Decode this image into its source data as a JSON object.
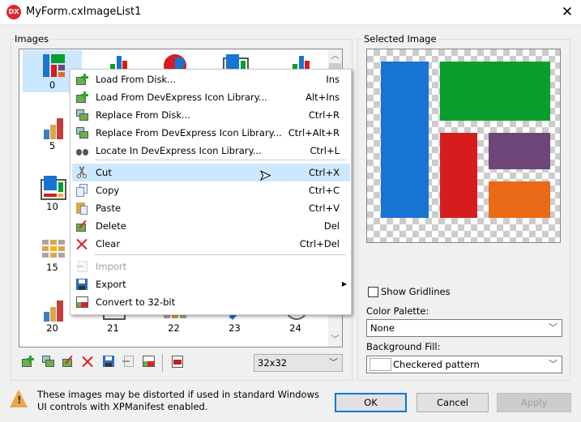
{
  "window": {
    "title": "MyForm.cxImageList1",
    "logo_text": "DX",
    "close_glyph": "✕"
  },
  "images_group": {
    "label": "Images",
    "cells": [
      {
        "label": "0",
        "icon": "layout-icon",
        "selected": true
      },
      {
        "label": "",
        "icon": "bar-chart-icon"
      },
      {
        "label": "",
        "icon": "pie-chart-icon"
      },
      {
        "label": "",
        "icon": "dashboard-icon"
      },
      {
        "label": "",
        "icon": "bar-chart-icon"
      },
      {
        "label": "5",
        "icon": "bar-chart-3d-icon"
      },
      {
        "label": "",
        "icon": ""
      },
      {
        "label": "",
        "icon": ""
      },
      {
        "label": "",
        "icon": ""
      },
      {
        "label": "",
        "icon": ""
      },
      {
        "label": "10",
        "icon": "dashboard-icon"
      },
      {
        "label": "",
        "icon": ""
      },
      {
        "label": "",
        "icon": ""
      },
      {
        "label": "",
        "icon": ""
      },
      {
        "label": "",
        "icon": ""
      },
      {
        "label": "15",
        "icon": "grid-icon"
      },
      {
        "label": "",
        "icon": ""
      },
      {
        "label": "",
        "icon": ""
      },
      {
        "label": "",
        "icon": ""
      },
      {
        "label": "",
        "icon": ""
      },
      {
        "label": "20",
        "icon": "bar-chart-3d-icon"
      },
      {
        "label": "21",
        "icon": "window-icon"
      },
      {
        "label": "22",
        "icon": "grid-icon"
      },
      {
        "label": "23",
        "icon": "pencil-icon"
      },
      {
        "label": "24",
        "icon": "circle-icon"
      }
    ],
    "size_combo": {
      "value": "32x32"
    },
    "toolbar": [
      "add-image-icon",
      "replace-image-icon",
      "delete-image-icon",
      "clear-icon",
      "save-icon",
      "import-icon",
      "convert-32-icon",
      "image-editor-icon"
    ]
  },
  "context_menu": {
    "items": [
      {
        "label": "Load From Disk...",
        "shortcut": "Ins",
        "icon": "add-image-icon"
      },
      {
        "label": "Load From DevExpress Icon Library...",
        "shortcut": "Alt+Ins",
        "icon": "add-image-icon"
      },
      {
        "label": "Replace From Disk...",
        "shortcut": "Ctrl+R",
        "icon": "replace-image-icon"
      },
      {
        "label": "Replace From DevExpress Icon Library...",
        "shortcut": "Ctrl+Alt+R",
        "icon": "replace-image-icon"
      },
      {
        "label": "Locate In DevExpress Icon Library...",
        "shortcut": "Ctrl+L",
        "icon": "binoculars-icon"
      },
      {
        "label": "Cut",
        "shortcut": "Ctrl+X",
        "icon": "scissors-icon",
        "highlighted": true
      },
      {
        "label": "Copy",
        "shortcut": "Ctrl+C",
        "icon": "copy-icon"
      },
      {
        "label": "Paste",
        "shortcut": "Ctrl+V",
        "icon": "paste-icon"
      },
      {
        "label": "Delete",
        "shortcut": "Del",
        "icon": "delete-image-icon"
      },
      {
        "label": "Clear",
        "shortcut": "Ctrl+Del",
        "icon": "clear-icon"
      },
      {
        "label": "Import",
        "shortcut": "",
        "icon": "import-icon",
        "disabled": true
      },
      {
        "label": "Export",
        "shortcut": "",
        "icon": "save-icon",
        "submenu": true
      },
      {
        "label": "Convert to 32-bit",
        "shortcut": "",
        "icon": "convert-32-icon"
      }
    ]
  },
  "selected_image": {
    "label": "Selected Image",
    "show_gridlines": {
      "label": "Show Gridlines",
      "checked": false
    },
    "color_palette": {
      "label": "Color Palette:",
      "value": "None"
    },
    "background_fill": {
      "label": "Background Fill:",
      "value": "Checkered pattern"
    },
    "colors": {
      "blue": "#1874d2",
      "green": "#079e2c",
      "red": "#d61d1d",
      "purple": "#6e4579",
      "orange": "#ea6a17"
    }
  },
  "footer": {
    "warning": "These images may be distorted if used in standard Windows UI controls with XPManifest enabled.",
    "ok": "OK",
    "cancel": "Cancel",
    "apply": "Apply"
  }
}
